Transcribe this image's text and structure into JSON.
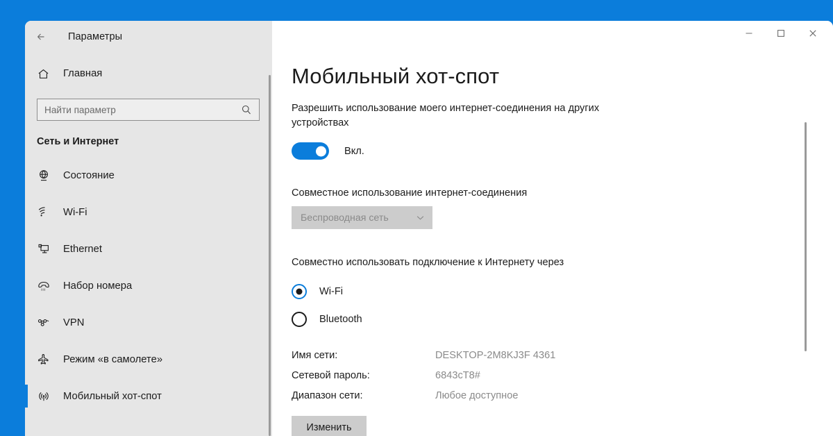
{
  "window": {
    "app_title": "Параметры",
    "back_icon": "back-arrow-icon",
    "minimize_label": "minimize-icon",
    "maximize_label": "maximize-icon",
    "close_label": "close-icon"
  },
  "sidebar": {
    "home_label": "Главная",
    "home_icon": "home-icon",
    "search": {
      "placeholder": "Найти параметр",
      "value": "",
      "icon": "search-icon"
    },
    "section_title": "Сеть и Интернет",
    "items": [
      {
        "label": "Состояние",
        "icon": "globe-icon",
        "selected": false
      },
      {
        "label": "Wi-Fi",
        "icon": "wifi-icon",
        "selected": false
      },
      {
        "label": "Ethernet",
        "icon": "monitor-icon",
        "selected": false
      },
      {
        "label": "Набор номера",
        "icon": "phone-handset-icon",
        "selected": false
      },
      {
        "label": "VPN",
        "icon": "vpn-icon",
        "selected": false
      },
      {
        "label": "Режим «в самолете»",
        "icon": "airplane-icon",
        "selected": false
      },
      {
        "label": "Мобильный хот-спот",
        "icon": "hotspot-icon",
        "selected": true
      }
    ]
  },
  "main": {
    "page_title": "Мобильный хот-спот",
    "description": "Разрешить использование моего интернет-соединения на других устройствах",
    "toggle": {
      "state_label": "Вкл.",
      "on": true
    },
    "share_connection_label": "Совместное использование интернет-соединения",
    "dropdown": {
      "value": "Беспроводная сеть",
      "disabled": true,
      "chevron_icon": "chevron-down-icon"
    },
    "share_via_label": "Совместно использовать подключение к Интернету через",
    "radios": [
      {
        "label": "Wi-Fi",
        "checked": true
      },
      {
        "label": "Bluetooth",
        "checked": false
      }
    ],
    "info": [
      {
        "key": "Имя сети:",
        "value": "DESKTOP-2M8KJ3F 4361"
      },
      {
        "key": "Сетевой пароль:",
        "value": "6843cT8#"
      },
      {
        "key": "Диапазон сети:",
        "value": "Любое доступное"
      }
    ],
    "change_button": "Изменить"
  },
  "colors": {
    "accent": "#0b7ddb",
    "desktop_background": "#0b7ddb",
    "sidebar_background": "#e6e6e6",
    "content_background": "#ffffff",
    "disabled_control": "#cccccc"
  }
}
